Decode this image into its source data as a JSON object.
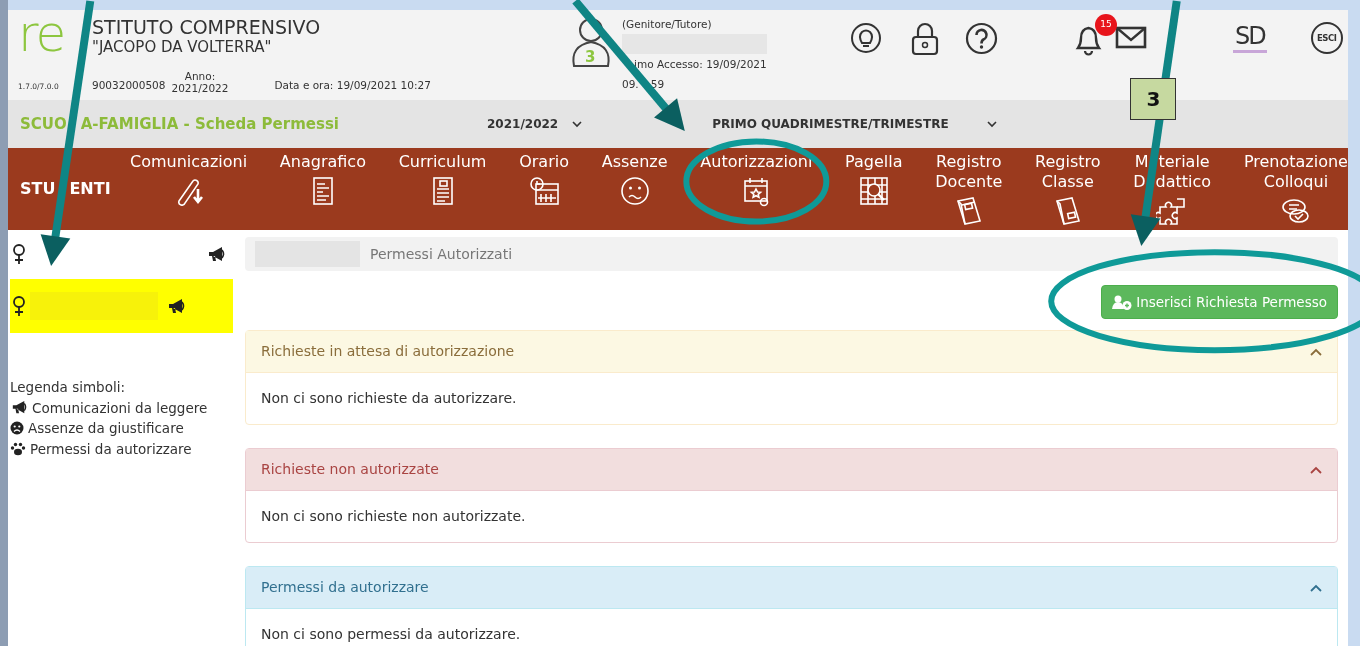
{
  "header": {
    "logo": "re",
    "version": "1.7.0/7.0.0",
    "title_line_1": "STITUTO COMPRENSIVO",
    "title_line_2": "\"JACOPO DA VOLTERRA\"",
    "school_code": "90032000508",
    "year_label": "Anno:",
    "year": "2021/2022",
    "datetime": "Data e ora: 19/09/2021 10:27",
    "user": {
      "avatar_number": "3",
      "role": "(Genitore/Tutore)",
      "last_access": "imo Accesso: 19/09/2021",
      "last_access_time": [
        "09.",
        "59"
      ]
    },
    "notifications_count": "15",
    "brand": "SD",
    "logout": "ESCI"
  },
  "subbar": {
    "title": [
      "SCUO",
      "A-FAMIGLIA - Scheda Permessi"
    ],
    "year_select": "2021/2022",
    "period_select": "PRIMO QUADRIMESTRE/TRIMESTRE"
  },
  "nav": {
    "section": [
      "STU",
      "ENTI"
    ],
    "items": [
      {
        "lines": [
          [
            "Comunicazioni"
          ]
        ]
      },
      {
        "lines": [
          [
            "Anagrafico"
          ]
        ]
      },
      {
        "lines": [
          [
            "Curriculum"
          ]
        ]
      },
      {
        "lines": [
          [
            "Orario"
          ]
        ]
      },
      {
        "lines": [
          [
            "Assenze"
          ]
        ]
      },
      {
        "lines": [
          [
            "Autorizzazioni"
          ]
        ]
      },
      {
        "lines": [
          [
            "Pagella"
          ]
        ]
      },
      {
        "lines": [
          [
            "Registro"
          ],
          [
            "Docente"
          ]
        ]
      },
      {
        "lines": [
          [
            "Registro"
          ],
          [
            "Classe"
          ]
        ]
      },
      {
        "lines": [
          [
            "M",
            "teriale"
          ],
          [
            "D",
            "dattico"
          ]
        ]
      },
      {
        "lines": [
          [
            "Prenotazione"
          ],
          [
            "Colloqui"
          ]
        ]
      }
    ]
  },
  "sidebar": {
    "students": [
      {
        "selected": false
      },
      {
        "selected": true
      }
    ],
    "legend": {
      "title": "Legenda simboli:",
      "items": [
        "Comunicazioni da leggere",
        "Assenze da giustificare",
        "Permessi da autorizzare"
      ]
    }
  },
  "breadcrumb": "Permessi Autorizzati",
  "action_button": "Inserisci Richiesta Permesso",
  "panels": [
    {
      "kind": "warning",
      "title": "Richieste in attesa di autorizzazione",
      "expanded": true,
      "message": "Non ci sono richieste da autorizzare."
    },
    {
      "kind": "danger",
      "title": "Richieste non autorizzate",
      "expanded": true,
      "message": "Non ci sono richieste non autorizzate."
    },
    {
      "kind": "info",
      "title": "Permessi da autorizzare",
      "expanded": true,
      "message": "Non ci sono permessi da autorizzare."
    }
  ],
  "callout_label": "3"
}
